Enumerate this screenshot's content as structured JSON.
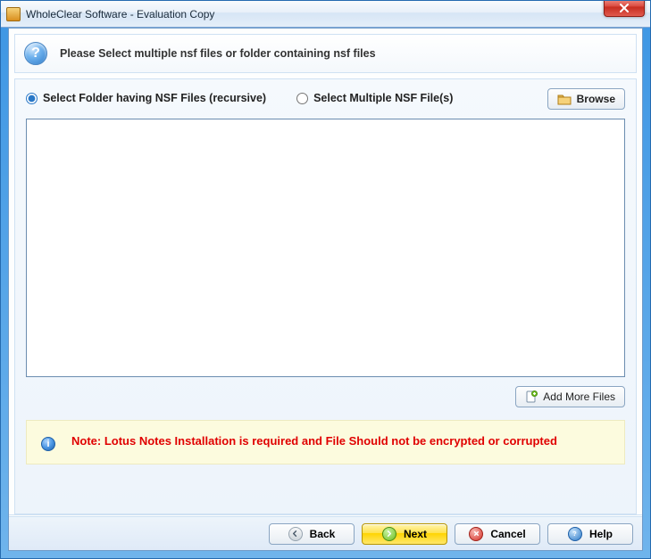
{
  "window": {
    "title": "WholeClear Software - Evaluation Copy"
  },
  "header": {
    "instruction": "Please Select multiple nsf files or folder containing nsf files"
  },
  "options": {
    "folder_label": "Select Folder having NSF Files (recursive)",
    "files_label": "Select Multiple NSF File(s)",
    "selected": "folder",
    "browse_label": "Browse",
    "add_more_label": "Add More Files"
  },
  "note": {
    "text": "Note: Lotus Notes Installation is required and File Should not be encrypted or corrupted"
  },
  "footer": {
    "back": "Back",
    "next": "Next",
    "cancel": "Cancel",
    "help": "Help"
  },
  "icons": {
    "help": "?",
    "info": "i"
  }
}
